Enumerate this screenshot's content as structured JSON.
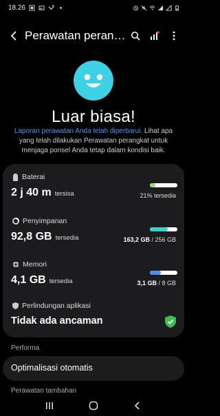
{
  "status_bar": {
    "time": "18.26"
  },
  "app_bar": {
    "title": "Perawatan perangkat"
  },
  "hero": {
    "title": "Luar biasa!",
    "link_text": "Laporan perawatan Anda telah diperbarui.",
    "desc_text": " Lihat apa yang telah dilakukan Perawatan perangkat untuk menjaga ponsel Anda tetap dalam kondisi baik."
  },
  "battery": {
    "label": "Baterai",
    "value": "2 j 40 m",
    "suffix": "tersisa",
    "right": "21% tersedia",
    "level": 0.21,
    "color": "#8ee07a"
  },
  "storage": {
    "label": "Penyimpanan",
    "value": "92,8 GB",
    "suffix": "tersedia",
    "used": "163,2 GB",
    "total": " / 256 GB",
    "level": 0.64,
    "color": "#3cd1c4"
  },
  "memory": {
    "label": "Memori",
    "value": "4,1 GB",
    "suffix": "tersedia",
    "used": "3,1 GB",
    "total": " / 8 GB",
    "level": 0.39,
    "color": "#4a8cf0"
  },
  "protection": {
    "label": "Perlindungan aplikasi",
    "value": "Tidak ada ancaman",
    "color": "#3cbf4f"
  },
  "performance": {
    "section": "Performa",
    "item": "Optimalisasi otomatis"
  },
  "extra": {
    "section": "Perawatan tambahan"
  }
}
